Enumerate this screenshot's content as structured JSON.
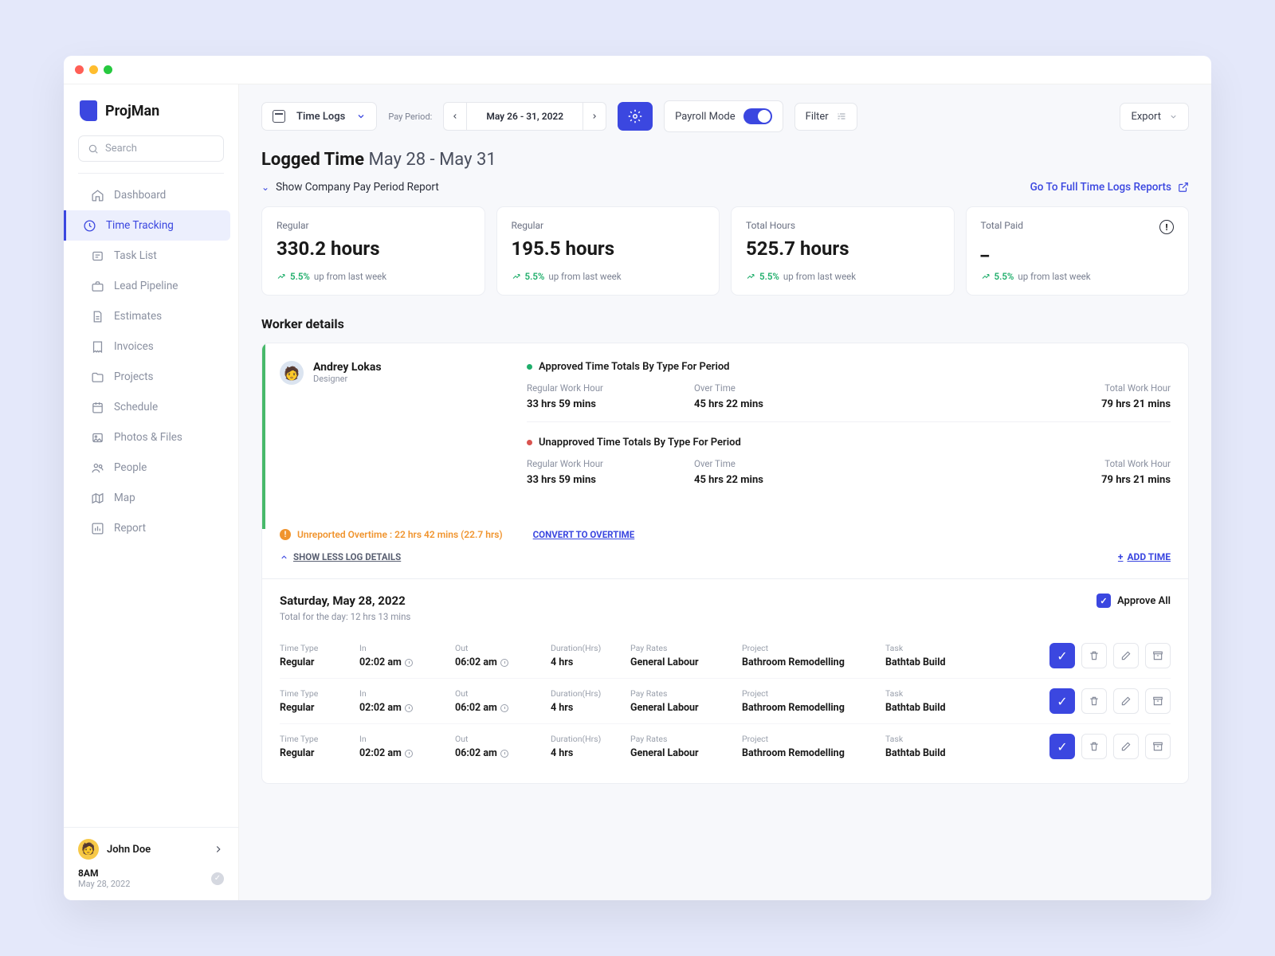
{
  "brand": "ProjMan",
  "search_placeholder": "Search",
  "nav": [
    {
      "label": "Dashboard",
      "icon": "home"
    },
    {
      "label": "Time Tracking",
      "icon": "clock",
      "active": true
    },
    {
      "label": "Task List",
      "icon": "list"
    },
    {
      "label": "Lead Pipeline",
      "icon": "briefcase"
    },
    {
      "label": "Estimates",
      "icon": "doc"
    },
    {
      "label": "Invoices",
      "icon": "invoice"
    },
    {
      "label": "Projects",
      "icon": "folder"
    },
    {
      "label": "Schedule",
      "icon": "calendar"
    },
    {
      "label": "Photos & Files",
      "icon": "image"
    },
    {
      "label": "People",
      "icon": "people"
    },
    {
      "label": "Map",
      "icon": "map"
    },
    {
      "label": "Report",
      "icon": "chart"
    }
  ],
  "user": {
    "name": "John Doe",
    "time": "8AM",
    "date": "May 28, 2022"
  },
  "toolbar": {
    "selector": "Time Logs",
    "pay_period_label": "Pay Period:",
    "pay_period_value": "May 26 - 31, 2022",
    "payroll_mode": "Payroll Mode",
    "filter": "Filter",
    "export": "Export"
  },
  "page": {
    "title": "Logged Time",
    "range": "May 28 - May 31",
    "show_report": "Show Company Pay Period Report",
    "goto": "Go To Full Time Logs Reports"
  },
  "cards": [
    {
      "title": "Regular",
      "value": "330.2 hours",
      "pct": "5.5%",
      "rest": "up from last week"
    },
    {
      "title": "Regular",
      "value": "195.5 hours",
      "pct": "5.5%",
      "rest": "up from last week"
    },
    {
      "title": "Total Hours",
      "value": "525.7 hours",
      "pct": "5.5%",
      "rest": "up from last week"
    },
    {
      "title": "Total Paid",
      "value": "_",
      "pct": "5.5%",
      "rest": "up from last week",
      "warn": true
    }
  ],
  "worker_heading": "Worker details",
  "worker": {
    "name": "Andrey Lokas",
    "role": "Designer"
  },
  "periods": [
    {
      "title": "Approved Time Totals By Type For Period",
      "color": "g",
      "cols": [
        {
          "l": "Regular Work Hour",
          "v": "33 hrs 59 mins"
        },
        {
          "l": "Over Time",
          "v": "45 hrs 22 mins"
        },
        {
          "l": "Total Work Hour",
          "v": "79 hrs 21 mins"
        }
      ]
    },
    {
      "title": "Unapproved Time Totals By Type For Period",
      "color": "r",
      "cols": [
        {
          "l": "Regular Work Hour",
          "v": "33 hrs 59 mins"
        },
        {
          "l": "Over Time",
          "v": "45 hrs 22 mins"
        },
        {
          "l": "Total Work Hour",
          "v": "79 hrs 21 mins"
        }
      ]
    }
  ],
  "alert": "Unreported Overtime : 22 hrs 42 mins (22.7 hrs)",
  "convert": "CONVERT TO OVERTIME",
  "showless": "SHOW LESS LOG DETAILS",
  "addtime": "ADD TIME",
  "logday": {
    "date": "Saturday, May 28, 2022",
    "total": "Total for the day: 12 hrs 13 mins",
    "approve_all": "Approve All",
    "cols": [
      "Time Type",
      "In",
      "Out",
      "Duration(Hrs)",
      "Pay Rates",
      "Project",
      "Task"
    ],
    "rows": [
      {
        "type": "Regular",
        "in": "02:02 am",
        "out": "06:02 am",
        "dur": "4 hrs",
        "rate": "General Labour",
        "proj": "Bathroom Remodelling",
        "task": "Bathtab Build"
      },
      {
        "type": "Regular",
        "in": "02:02 am",
        "out": "06:02 am",
        "dur": "4 hrs",
        "rate": "General Labour",
        "proj": "Bathroom Remodelling",
        "task": "Bathtab Build"
      },
      {
        "type": "Regular",
        "in": "02:02 am",
        "out": "06:02 am",
        "dur": "4 hrs",
        "rate": "General Labour",
        "proj": "Bathroom Remodelling",
        "task": "Bathtab Build"
      }
    ]
  }
}
